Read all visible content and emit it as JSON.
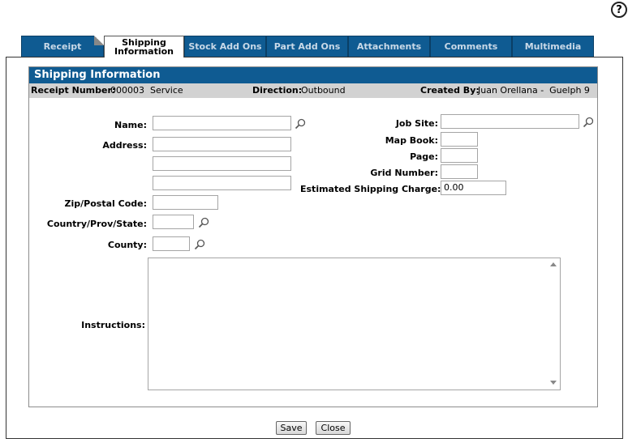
{
  "help": {
    "symbol": "?"
  },
  "tabs": [
    {
      "label": "Receipt"
    },
    {
      "label": "Shipping Information"
    },
    {
      "label": "Stock Add Ons"
    },
    {
      "label": "Part Add Ons"
    },
    {
      "label": "Attachments"
    },
    {
      "label": "Comments"
    },
    {
      "label": "Multimedia"
    }
  ],
  "active_tab": {
    "line1": "Shipping",
    "line2": "Information"
  },
  "panel": {
    "title": "Shipping Information"
  },
  "info_bar": {
    "receipt_label": "Receipt Number:",
    "receipt_value": "000003  Service",
    "direction_label": "Direction:",
    "direction_value": "Outbound",
    "created_label": "Created By:",
    "created_value": "Juan Orellana -  Guelph 9"
  },
  "form": {
    "name_label": "Name:",
    "name_value": "",
    "address_label": "Address:",
    "address_line1": "",
    "address_line2": "",
    "address_line3": "",
    "zip_label": "Zip/Postal Code:",
    "zip_value": "",
    "country_label": "Country/Prov/State:",
    "country_value": "",
    "county_label": "County:",
    "county_value": "",
    "instructions_label": "Instructions:",
    "instructions_value": "",
    "job_site_label": "Job Site:",
    "job_site_value": "",
    "map_book_label": "Map Book:",
    "map_book_value": "",
    "page_label": "Page:",
    "page_value": "",
    "grid_label": "Grid Number:",
    "grid_value": "",
    "shipping_charge_label": "Estimated Shipping Charge:",
    "shipping_charge_value": "0.00"
  },
  "buttons": {
    "save": "Save",
    "close": "Close"
  },
  "colors": {
    "tab_blue": "#0f5b92",
    "info_bar_gray": "#d2d2d2"
  }
}
